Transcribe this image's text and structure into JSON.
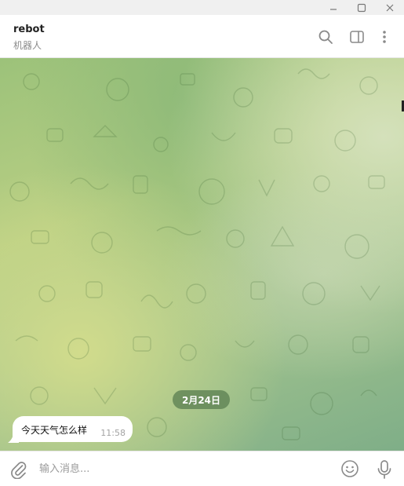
{
  "window": {
    "controls": [
      "minimize",
      "maximize",
      "close"
    ]
  },
  "header": {
    "chat_name": "rebot",
    "chat_status": "机器人",
    "icons": [
      "search-icon",
      "sidebar-toggle-icon",
      "more-vertical-icon"
    ]
  },
  "chat": {
    "date_separator": "2月24日",
    "messages": [
      {
        "text": "今天天气怎么样",
        "time": "11:58",
        "direction": "incoming"
      }
    ]
  },
  "composer": {
    "placeholder": "输入消息...",
    "icons": [
      "paperclip-icon",
      "emoji-icon",
      "microphone-icon"
    ]
  },
  "colors": {
    "accent": "#5a7d50",
    "bubble": "#ffffff",
    "icon": "#8a8a8a"
  }
}
